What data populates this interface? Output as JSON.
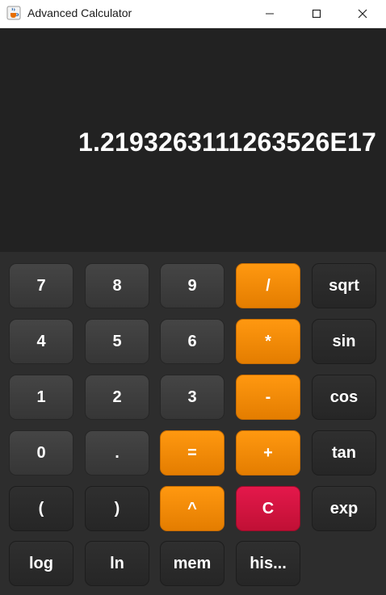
{
  "window": {
    "title": "Advanced Calculator",
    "icon": "java-cup-icon",
    "controls": [
      "minimize-icon",
      "maximize-icon",
      "close-icon"
    ]
  },
  "display": {
    "value": "1.2193263111263526E17"
  },
  "keypad": {
    "rows": [
      [
        "7",
        "8",
        "9",
        "/",
        "sqrt"
      ],
      [
        "4",
        "5",
        "6",
        "*",
        "sin"
      ],
      [
        "1",
        "2",
        "3",
        "-",
        "cos"
      ],
      [
        "0",
        ".",
        "=",
        "+",
        "tan"
      ],
      [
        "(",
        ")",
        "^",
        "C",
        "exp"
      ],
      [
        "log",
        "ln",
        "mem",
        "his..."
      ]
    ]
  },
  "colors": {
    "accent_orange": "#f08a05",
    "clear_red": "#d4143f",
    "digit_gray": "#3e3e3e",
    "function_dark": "#2a2a2a",
    "display_bg": "#222222"
  }
}
